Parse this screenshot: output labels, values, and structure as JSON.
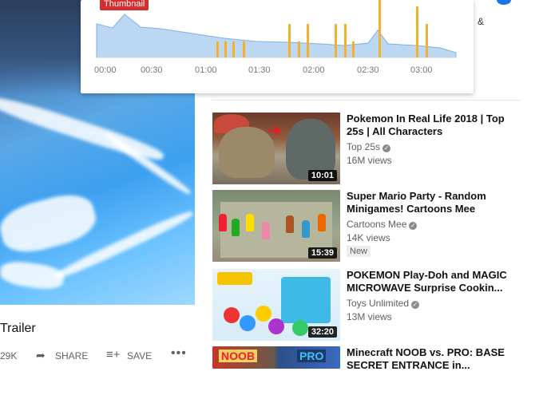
{
  "player": {
    "title": "Trailer",
    "likes": "29K",
    "share_label": "SHARE",
    "save_label": "SAVE",
    "more_icon": "more-horizontal-icon"
  },
  "storyboard": {
    "badge": "Thumbnail",
    "ticks": [
      "00:00",
      "00:30",
      "01:00",
      "01:30",
      "02:00",
      "02:30",
      "03:00"
    ],
    "accent": "#f0b030",
    "graph_fill": "#bcd7f2"
  },
  "side": {
    "amp": "&"
  },
  "related": [
    {
      "title": "Pokemon In Real Life 2018 | Top 25s | All Characters",
      "channel": "Top 25s",
      "views": "16M views",
      "duration": "10:01",
      "badge": ""
    },
    {
      "title": "Super Mario Party - Random Minigames! Cartoons Mee",
      "channel": "Cartoons Mee",
      "views": "14K views",
      "duration": "15:39",
      "badge": "New"
    },
    {
      "title": "POKEMON Play-Doh and MAGIC MICROWAVE Surprise Cookin...",
      "channel": "Toys Unlimited",
      "views": "13M views",
      "duration": "32:20",
      "badge": ""
    },
    {
      "title": "Minecraft NOOB vs. PRO: BASE SECRET ENTRANCE in...",
      "channel": "",
      "views": "",
      "duration": "",
      "badge": "",
      "thumb_text_left": "NOOB",
      "thumb_text_right": "PRO"
    }
  ]
}
